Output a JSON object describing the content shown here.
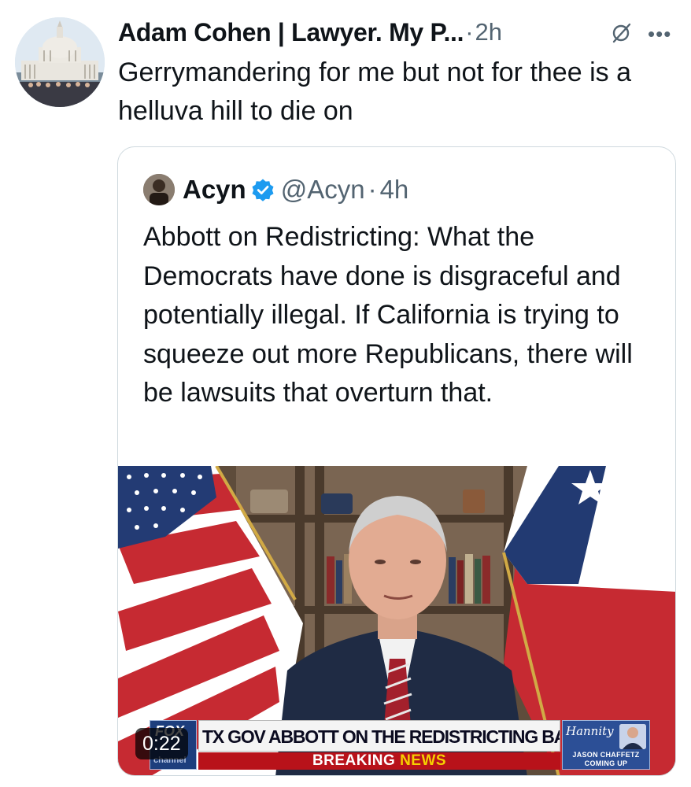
{
  "tweet": {
    "author_display_name": "Adam Cohen | Lawyer. My P...",
    "separator": "·",
    "time": "2h",
    "text": "Gerrymandering for me but not for thee is a helluva hill to die on",
    "avatar_icon": "capitol-building-avatar",
    "muted_icon": "muted-icon",
    "more_icon": "more-options-icon"
  },
  "quote": {
    "author_name": "Acyn",
    "handle": "@Acyn",
    "separator": "·",
    "time": "4h",
    "verified_icon": "verified-badge-icon",
    "text": "Abbott on Redistricting: What the Democrats have done is disgraceful and potentially illegal. If California is trying to squeeze out more Republicans, there will be lawsuits that overturn that.",
    "video": {
      "duration": "0:22",
      "chyron_headline": "TX GOV ABBOTT ON THE REDISTRICTING BATTLE",
      "chyron_sub_a": "BREAKING",
      "chyron_sub_b": "NEWS",
      "network_logo": "FOX",
      "network_sub": "channel",
      "show_name": "Hannity",
      "upnext_name": "JASON CHAFFETZ",
      "upnext_label": "COMING UP"
    }
  },
  "colors": {
    "text_primary": "#0f1419",
    "text_secondary": "#536471",
    "verified_blue": "#1d9bf0",
    "card_border": "#cfd9de",
    "breaking_red": "#b8121a"
  }
}
